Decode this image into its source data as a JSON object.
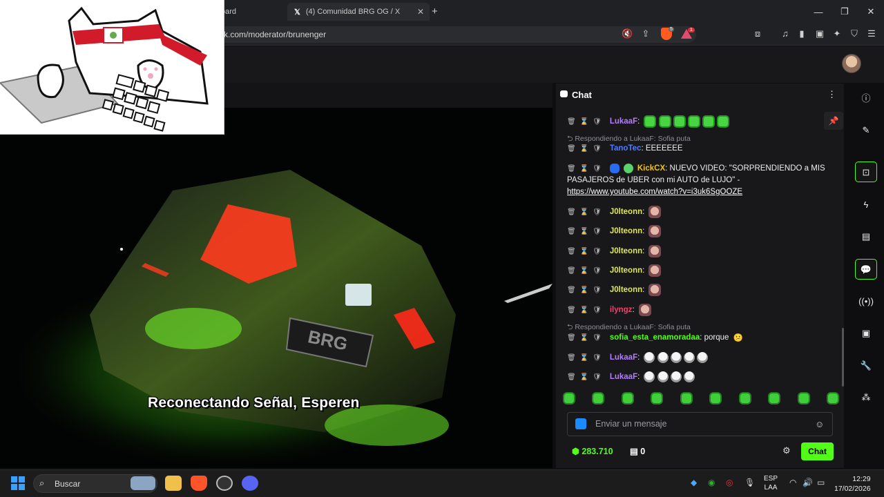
{
  "browser": {
    "tabs": [
      {
        "title": "oard",
        "icon": "dashboard-icon"
      },
      {
        "title": "(4) Comunidad BRG OG / X",
        "icon": "x-logo-icon"
      }
    ],
    "new_tab": "+",
    "url": "ck.com/moderator/brunenger",
    "window_controls": [
      "—",
      "❐",
      "✕"
    ],
    "shield_badge": "5",
    "alert_badge": "1"
  },
  "video": {
    "subtitle": "Reconectando Señal, Esperen",
    "plate_text": "BRG"
  },
  "chat": {
    "title": "Chat",
    "messages": [
      {
        "type": "msg",
        "user": "LukaaF",
        "text": ":",
        "emotes": "green-ghost x6"
      },
      {
        "type": "reply",
        "text": "Respondiendo a LukaaF: Sofia puta"
      },
      {
        "type": "msg",
        "user": "TanoTec",
        "text": ": EEEEEEE"
      },
      {
        "type": "msg",
        "user": "KickCX",
        "text": ": NUEVO VIDEO: \"SORPRENDIENDO a MIS",
        "line2": "PASAJEROS de UBER con mi AUTO de LUJO\" -",
        "link": "https://www.youtube.com/watch?v=i3uk6SgOOZE"
      },
      {
        "type": "msg",
        "user": "J0lteonn",
        "text": ":"
      },
      {
        "type": "msg",
        "user": "J0lteonn",
        "text": ":"
      },
      {
        "type": "msg",
        "user": "J0lteonn",
        "text": ":"
      },
      {
        "type": "msg",
        "user": "J0lteonn",
        "text": ":"
      },
      {
        "type": "msg",
        "user": "J0lteonn",
        "text": ":"
      },
      {
        "type": "msg",
        "user": "ilyngz",
        "text": ":"
      },
      {
        "type": "reply",
        "text": "Respondiendo a LukaaF: Sofia puta"
      },
      {
        "type": "msg",
        "user": "sofia_esta_enamoradaa",
        "text": ": porque"
      },
      {
        "type": "msg",
        "user": "LukaaF",
        "text": ":"
      },
      {
        "type": "msg",
        "user": "LukaaF",
        "text": ":"
      }
    ],
    "input_placeholder": "Enviar un mensaje",
    "points": "283.710",
    "store_count": "0",
    "send_label": "Chat"
  },
  "taskbar": {
    "search_label": "Buscar",
    "lang_line1": "ESP",
    "lang_line2": "LAA",
    "time": "12:29",
    "date": "17/02/2026"
  },
  "colors": {
    "kick_green": "#53fc18",
    "chat_bg": "#18181b",
    "page_bg": "#0e0e10"
  }
}
